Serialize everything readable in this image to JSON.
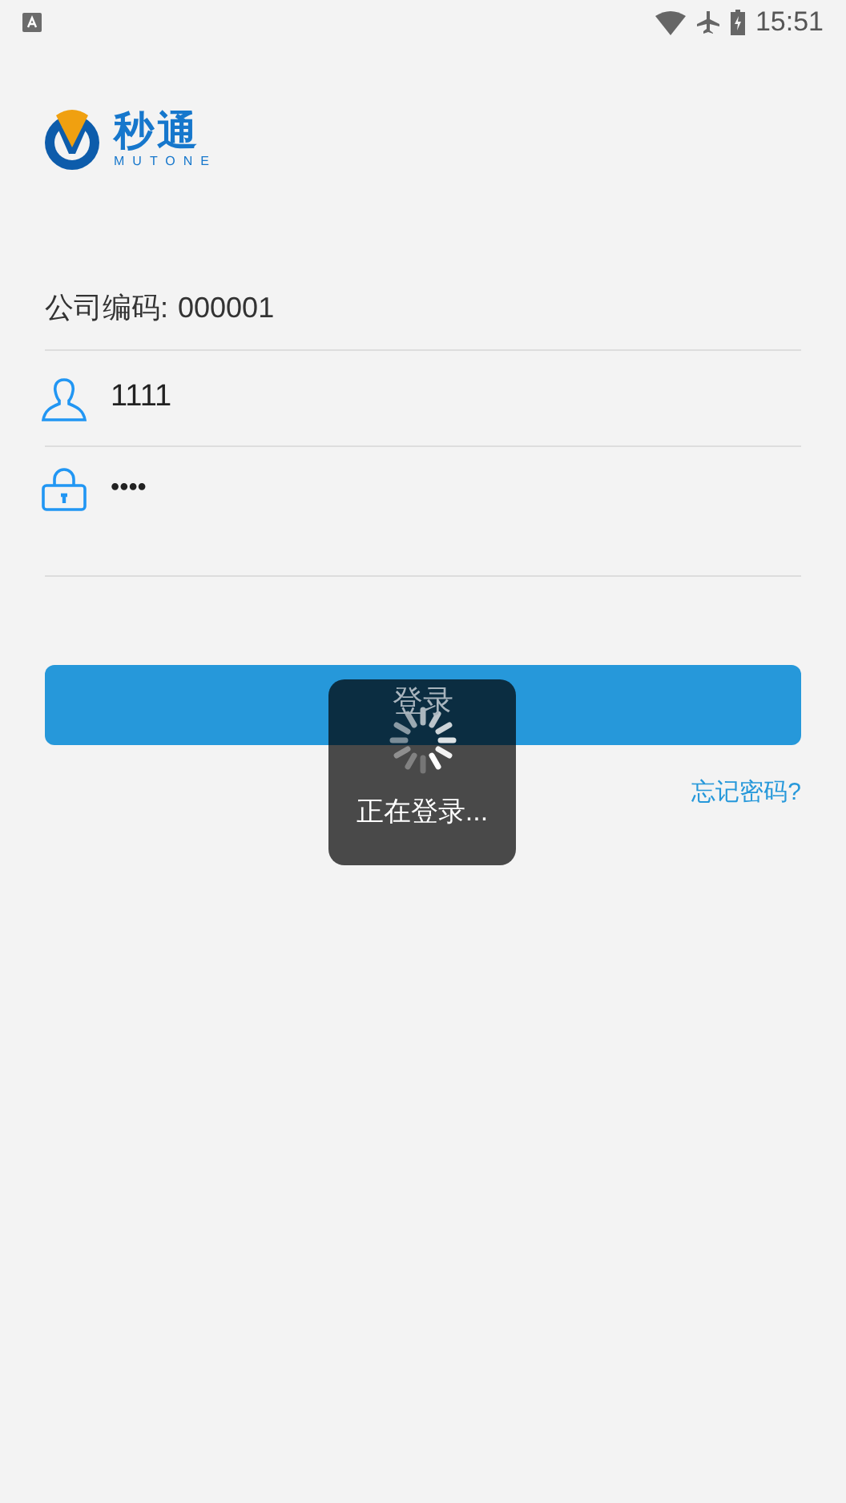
{
  "status_bar": {
    "time": "15:51"
  },
  "logo": {
    "name": "秒通",
    "subtitle": "MUTONE"
  },
  "company_code": {
    "label": "公司编码:",
    "value": "000001"
  },
  "username": {
    "value": "1111"
  },
  "password": {
    "value": "••••"
  },
  "login_button": {
    "label": "登录"
  },
  "forgot_password": {
    "label": "忘记密码?"
  },
  "loading_dialog": {
    "message": "正在登录..."
  }
}
